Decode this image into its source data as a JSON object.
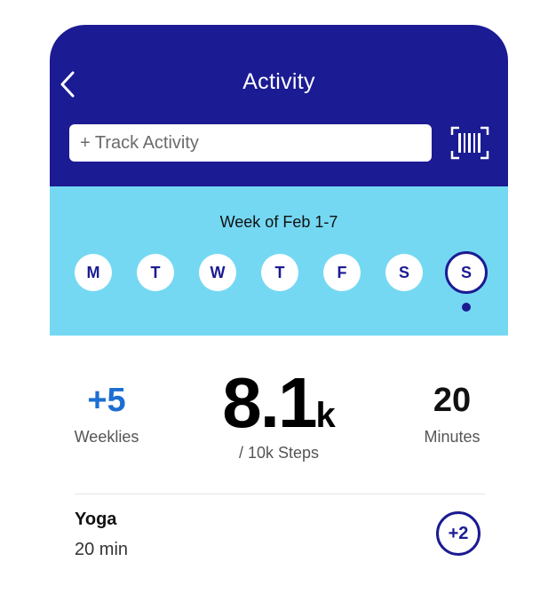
{
  "header": {
    "title": "Activity",
    "track_placeholder": "+ Track Activity"
  },
  "week": {
    "label": "Week of Feb 1-7",
    "days": [
      "M",
      "T",
      "W",
      "T",
      "F",
      "S",
      "S"
    ],
    "selected_index": 6
  },
  "stats": {
    "weeklies_value": "+5",
    "weeklies_label": "Weeklies",
    "steps_value": "8.1",
    "steps_unit": "k",
    "steps_goal": "/ 10k Steps",
    "minutes_value": "20",
    "minutes_label": "Minutes"
  },
  "activities": [
    {
      "name": "Yoga",
      "detail": "20 min",
      "points": "+2"
    }
  ],
  "colors": {
    "header_bg": "#1b1b93",
    "week_bg": "#75d8f3",
    "accent_blue": "#1c6fd1"
  },
  "icons": {
    "back": "chevron-left-icon",
    "scan": "barcode-scan-icon"
  }
}
